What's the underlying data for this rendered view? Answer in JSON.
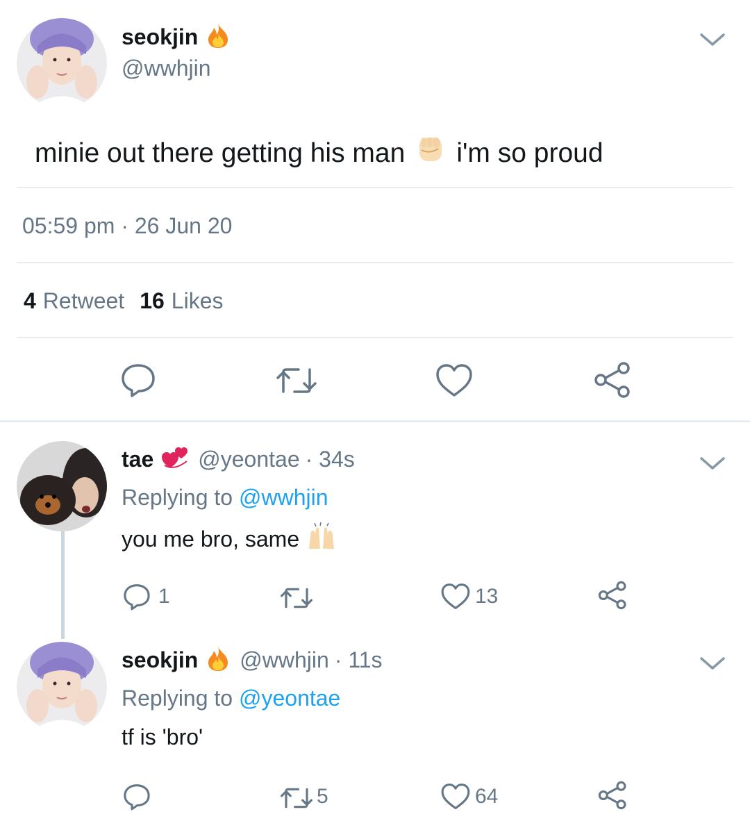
{
  "main_tweet": {
    "display_name": "seokjin",
    "handle": "@wwhjin",
    "text_before": "minie out there getting his man",
    "text_after": "i'm so proud",
    "time": "05:59 pm · 26 Jun 20",
    "retweet_count": "4",
    "retweet_label": "Retweet",
    "like_count": "16",
    "like_label": "Likes"
  },
  "replies": [
    {
      "display_name": "tae",
      "handle": "@yeontae",
      "age": "· 34s",
      "replying_prefix": "Replying to",
      "replying_to": "@wwhjin",
      "text": "you me bro, same",
      "reply_count": "1",
      "retweet_count": "",
      "like_count": "13"
    },
    {
      "display_name": "seokjin",
      "handle": "@wwhjin",
      "age": "· 11s",
      "replying_prefix": "Replying to",
      "replying_to": "@yeontae",
      "text": "tf is 'bro'",
      "reply_count": "",
      "retweet_count": "5",
      "like_count": "64"
    }
  ],
  "icons": {
    "main_actions": [
      "reply-icon",
      "retweet-icon",
      "like-icon",
      "share-icon"
    ],
    "menu": "chevron-down-icon",
    "emoji": [
      "fire-emoji",
      "raised-fist-emoji",
      "revolving-hearts-emoji",
      "raising-hands-emoji"
    ]
  },
  "colors": {
    "link": "#1da1f2",
    "muted": "#657786",
    "text": "#14171a",
    "divider": "#e6ecf0"
  }
}
